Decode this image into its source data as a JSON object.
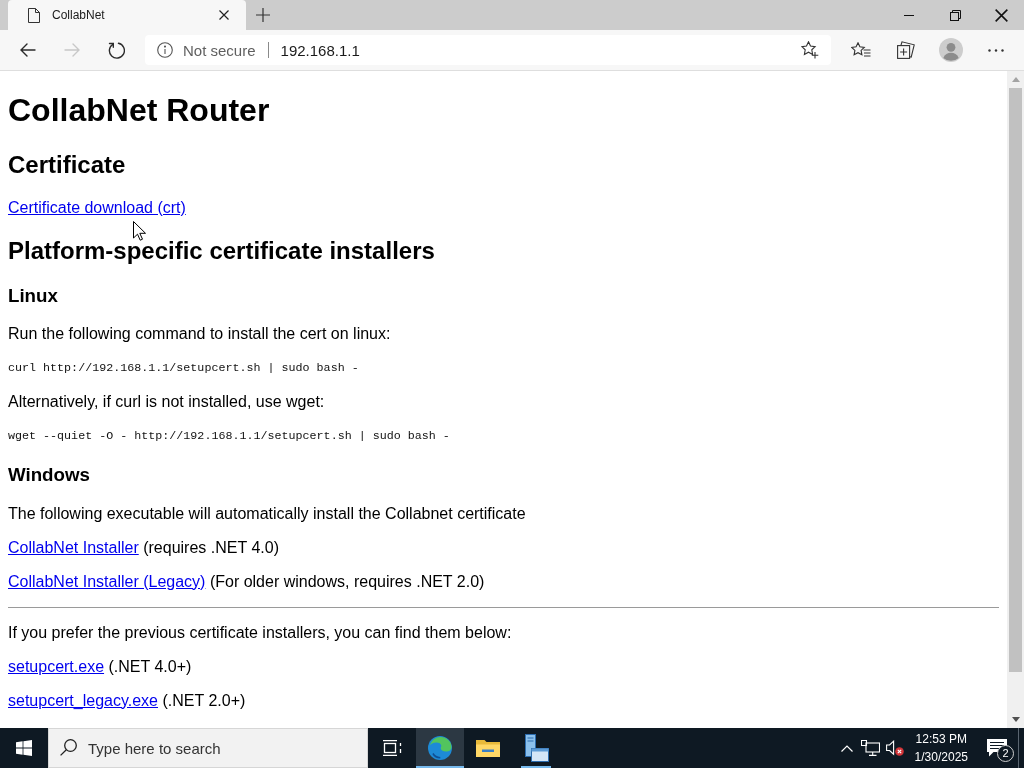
{
  "window": {
    "tabs": [
      {
        "title": "CollabNet",
        "selected": true
      }
    ],
    "toolbar": {
      "buttons": [
        {
          "kind": "back",
          "disabled": false
        },
        {
          "kind": "forward",
          "disabled": true
        },
        {
          "kind": "refresh",
          "disabled": false
        }
      ],
      "security_label": "Not secure",
      "url": "192.168.1.1"
    }
  },
  "content": [
    {
      "kind": "heading1",
      "text": "CollabNet Router"
    },
    {
      "kind": "heading2",
      "text": "Certificate"
    },
    {
      "kind": "link",
      "link": "Certificate download (crt)"
    },
    {
      "kind": "heading2",
      "text": "Platform-specific certificate installers"
    },
    {
      "kind": "heading3",
      "text": "Linux"
    },
    {
      "kind": "paragraph",
      "text": "Run the following command to install the cert on linux:"
    },
    {
      "kind": "code",
      "text": "curl http://192.168.1.1/setupcert.sh | sudo bash -"
    },
    {
      "kind": "paragraph",
      "text": "Alternatively, if curl is not installed, use wget:"
    },
    {
      "kind": "code",
      "text": "wget --quiet -O - http://192.168.1.1/setupcert.sh | sudo bash -"
    },
    {
      "kind": "heading3",
      "text": "Windows"
    },
    {
      "kind": "paragraph",
      "text": "The following executable will automatically install the Collabnet certificate"
    },
    {
      "kind": "link",
      "link": "CollabNet Installer",
      "note": "(requires .NET 4.0)"
    },
    {
      "kind": "link",
      "link": "CollabNet Installer (Legacy)",
      "note": "(For older windows, requires .NET 2.0)"
    },
    {
      "kind": "rule"
    },
    {
      "kind": "paragraph",
      "text": "If you prefer the previous certificate installers, you can find them below:"
    },
    {
      "kind": "link",
      "link": "setupcert.exe",
      "note": "(.NET 4.0+)"
    },
    {
      "kind": "link",
      "link": "setupcert_legacy.exe",
      "note": "(.NET 2.0+)"
    }
  ],
  "taskbar": {
    "search_placeholder": "Type here to search",
    "apps": [
      {
        "kind": "browser",
        "selected": true,
        "running": true
      },
      {
        "kind": "folder",
        "selected": false,
        "running": false
      },
      {
        "kind": "server",
        "selected": false,
        "running": true
      }
    ],
    "clock": {
      "time": "12:53 PM",
      "date": "1/30/2025"
    },
    "notification_count": "2"
  }
}
